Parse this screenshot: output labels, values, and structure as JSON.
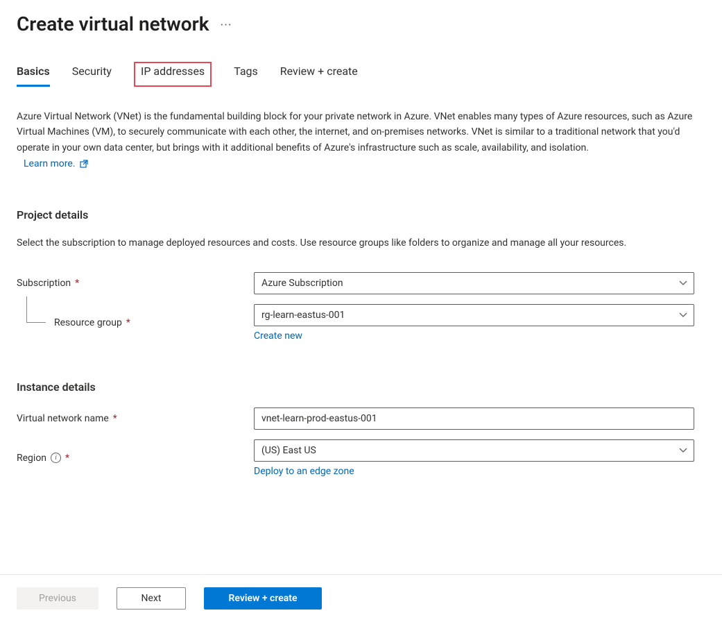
{
  "header": {
    "title": "Create virtual network"
  },
  "tabs": {
    "basics": "Basics",
    "security": "Security",
    "ip_addresses": "IP addresses",
    "tags": "Tags",
    "review_create": "Review + create"
  },
  "intro": {
    "description": "Azure Virtual Network (VNet) is the fundamental building block for your private network in Azure. VNet enables many types of Azure resources, such as Azure Virtual Machines (VM), to securely communicate with each other, the internet, and on-premises networks. VNet is similar to a traditional network that you'd operate in your own data center, but brings with it additional benefits of Azure's infrastructure such as scale, availability, and isolation.",
    "learn_more": "Learn more."
  },
  "project_details": {
    "title": "Project details",
    "description": "Select the subscription to manage deployed resources and costs. Use resource groups like folders to organize and manage all your resources.",
    "subscription_label": "Subscription",
    "subscription_value": "Azure Subscription",
    "resource_group_label": "Resource group",
    "resource_group_value": "rg-learn-eastus-001",
    "create_new": "Create new"
  },
  "instance_details": {
    "title": "Instance details",
    "vnet_name_label": "Virtual network name",
    "vnet_name_value": "vnet-learn-prod-eastus-001",
    "region_label": "Region",
    "region_value": "(US) East US",
    "deploy_edge": "Deploy to an edge zone"
  },
  "footer": {
    "previous": "Previous",
    "next": "Next",
    "review_create": "Review + create"
  }
}
